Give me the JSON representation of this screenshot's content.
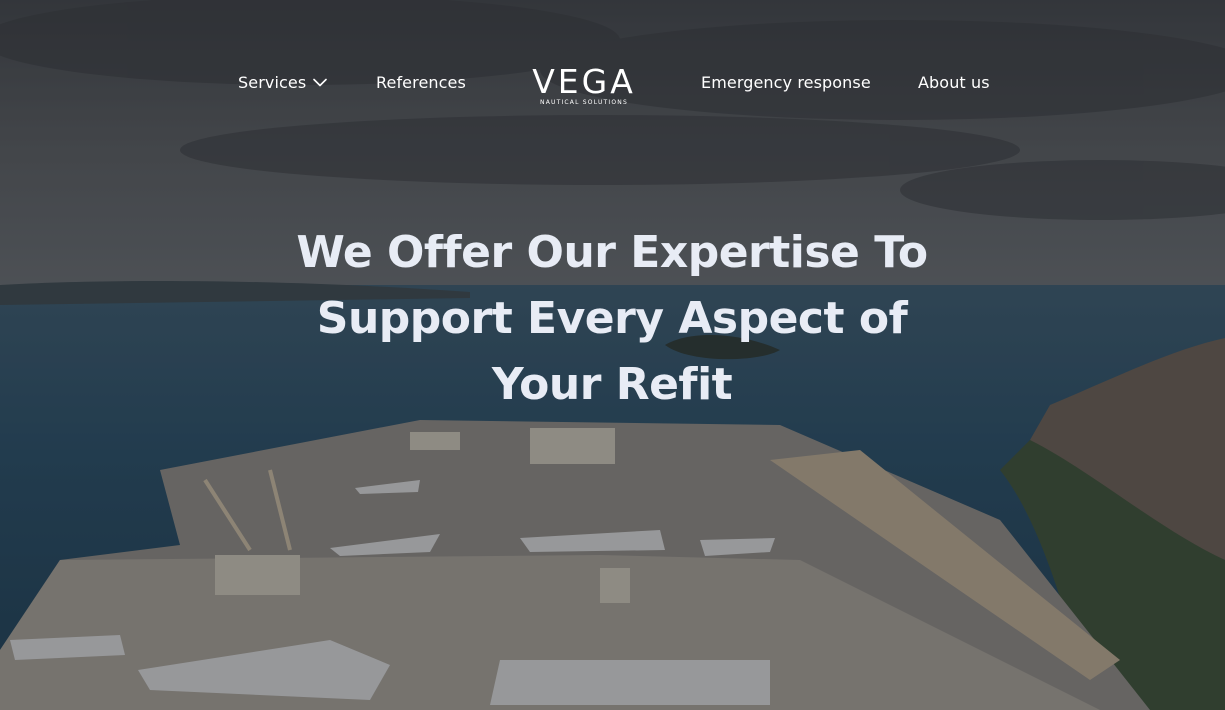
{
  "nav": {
    "services_label": "Services",
    "references_label": "References",
    "emergency_label": "Emergency response",
    "about_label": "About us"
  },
  "logo": {
    "wordmark": "VEGA",
    "tagline": "NAUTICAL SOLUTIONS"
  },
  "hero": {
    "headline": "We Offer Our Expertise To Support Every Aspect of Your Refit"
  },
  "icons": {
    "services_dropdown": "chevron-down-icon"
  },
  "colors": {
    "nav_text": "#ffffff",
    "headline_text": "#e8ecf5",
    "overlay": "rgba(20,22,28,0.32)"
  }
}
